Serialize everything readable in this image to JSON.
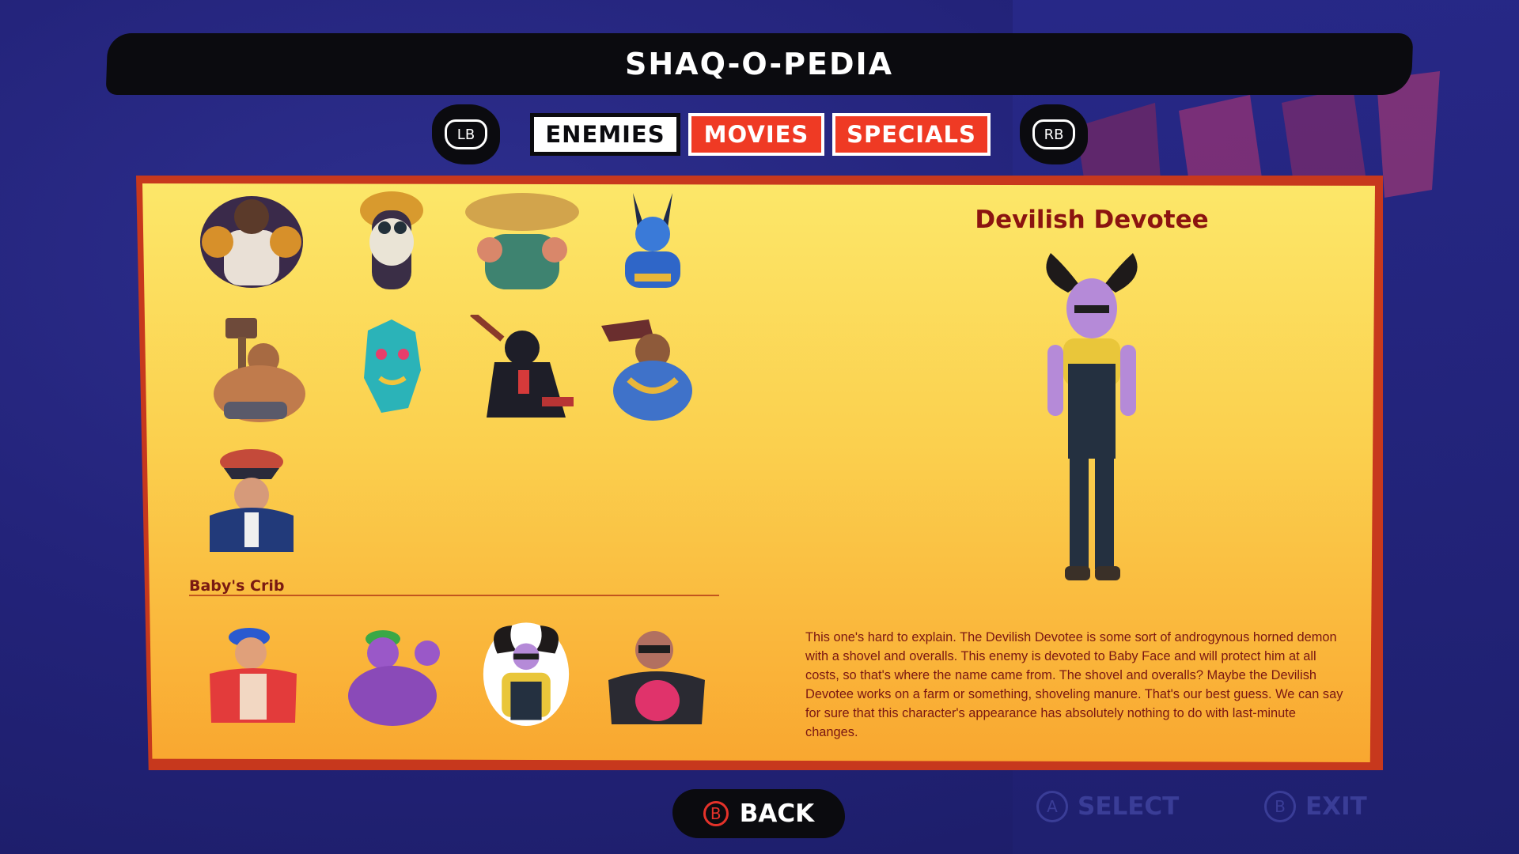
{
  "title": "SHAQ-O-PEDIA",
  "shoulder_left": "LB",
  "shoulder_right": "RB",
  "tabs": [
    {
      "label": "ENEMIES",
      "active": true
    },
    {
      "label": "MOVIES",
      "active": false
    },
    {
      "label": "SPECIALS",
      "active": false
    }
  ],
  "roster_icons": [
    "brawler-icon",
    "mushroom-monk-icon",
    "straw-hat-fighter-icon",
    "blue-horned-imp-icon",
    "hammer-brute-icon",
    "dragon-mask-icon",
    "ninja-icon",
    "gold-chain-brute-icon",
    "pirate-boss-icon"
  ],
  "section": {
    "label": "Baby's Crib",
    "icons": [
      "cap-fighter-icon",
      "green-cap-bodybuilder-icon",
      "devilish-devotee-icon",
      "bald-shades-thug-icon"
    ]
  },
  "selected": {
    "name": "Devilish Devotee",
    "description": "This one's hard to explain. The Devilish Devotee is some sort of androgynous horned demon with a shovel and overalls. This enemy is devoted to Baby Face and will protect him at all costs, so that's where the name came from. The shovel and overalls? Maybe the Devilish Devotee works on a farm or something, shoveling manure. That's our best guess. We can say for sure that this character's appearance has absolutely nothing to do with last-minute changes."
  },
  "footer": {
    "back_button": "B",
    "back_label": "BACK",
    "select_button": "A",
    "select_label": "SELECT",
    "exit_button": "B",
    "exit_label": "EXIT"
  },
  "colors": {
    "tab_inactive": "#ef3a24",
    "panel_top": "#fce769",
    "panel_bottom": "#f9a730",
    "name_text": "#8b1410"
  }
}
